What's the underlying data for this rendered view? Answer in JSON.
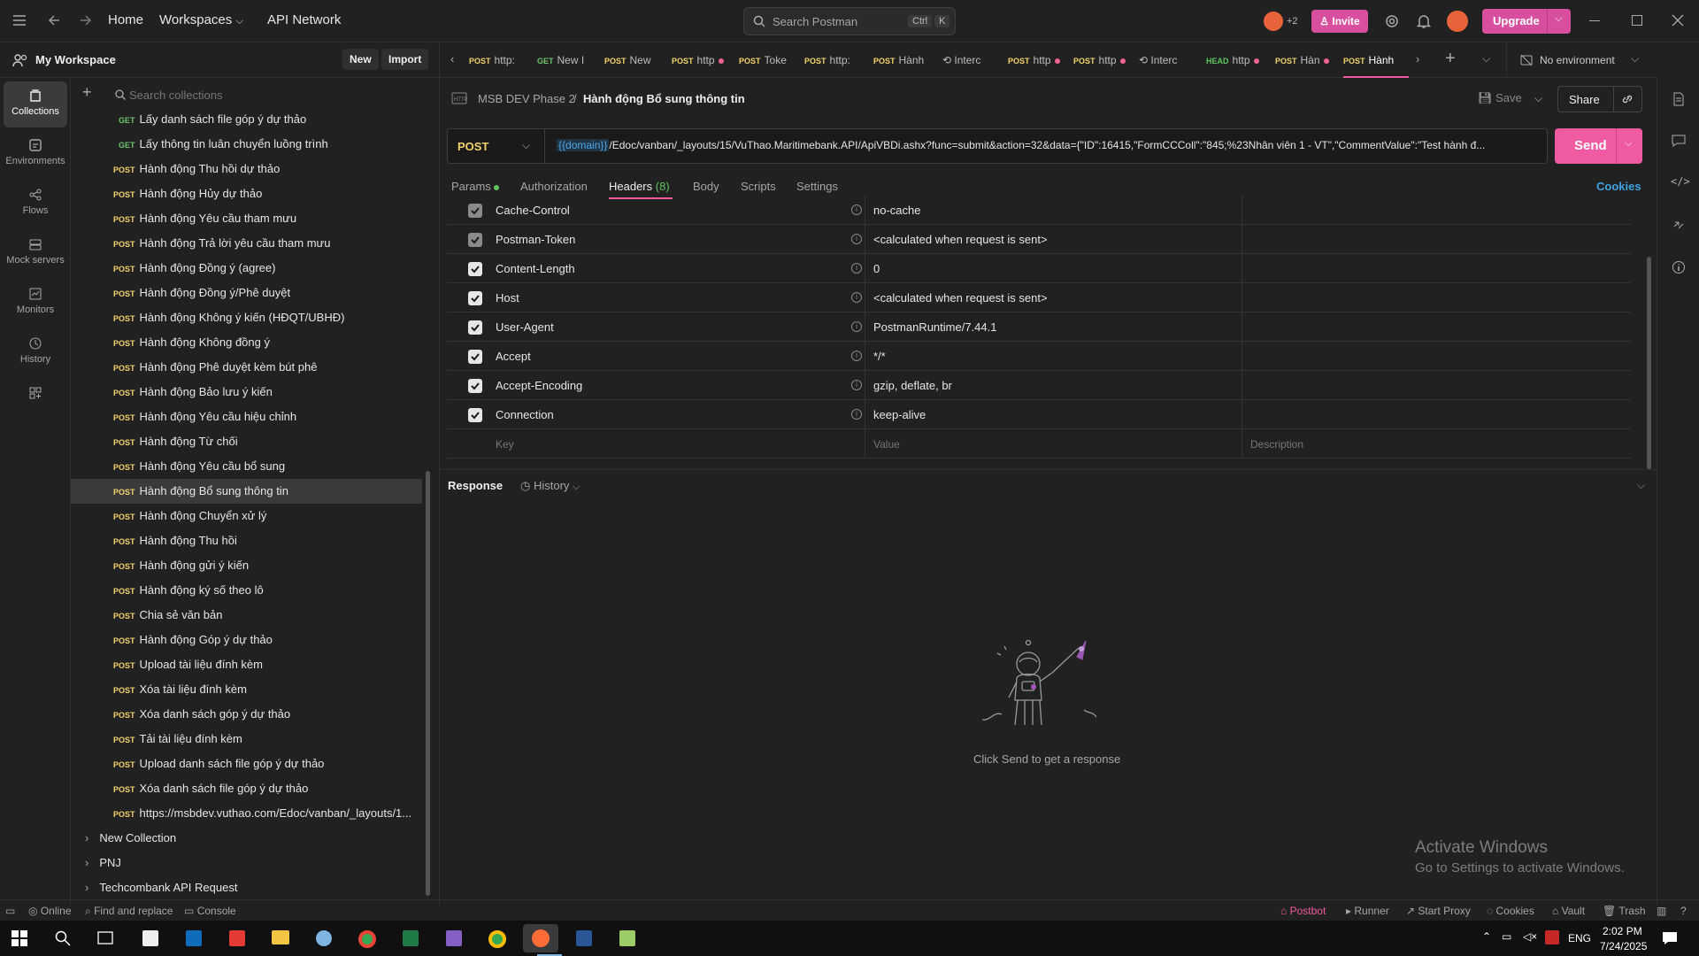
{
  "topbar": {
    "home": "Home",
    "workspaces": "Workspaces",
    "api_network": "API Network",
    "search_placeholder": "Search Postman",
    "search_kbd1": "Ctrl",
    "search_kbd2": "K",
    "avatar_count": "+2",
    "invite": "Invite",
    "upgrade": "Upgrade"
  },
  "workspace": {
    "title": "My Workspace",
    "new": "New",
    "import": "Import"
  },
  "rail": [
    {
      "label": "Collections",
      "icon": "collections-icon",
      "active": true
    },
    {
      "label": "Environments",
      "icon": "environments-icon"
    },
    {
      "label": "Flows",
      "icon": "flows-icon"
    },
    {
      "label": "Mock servers",
      "icon": "mock-servers-icon"
    },
    {
      "label": "Monitors",
      "icon": "monitors-icon"
    },
    {
      "label": "History",
      "icon": "history-icon"
    }
  ],
  "sidebar": {
    "search_placeholder": "Search collections",
    "items": [
      {
        "m": "GET",
        "label": "Lấy danh sách file góp ý dự thảo",
        "indent": 1
      },
      {
        "m": "GET",
        "label": "Lấy thông tin luân chuyển luồng trình",
        "indent": 1
      },
      {
        "m": "POST",
        "label": "Hành động Thu hồi dự thảo"
      },
      {
        "m": "POST",
        "label": "Hành động Hủy dự thảo"
      },
      {
        "m": "POST",
        "label": "Hành động Yêu cầu tham mưu"
      },
      {
        "m": "POST",
        "label": "Hành động Trả lời yêu cầu tham mưu"
      },
      {
        "m": "POST",
        "label": "Hành động Đồng ý (agree)"
      },
      {
        "m": "POST",
        "label": "Hành động Đồng ý/Phê duyệt"
      },
      {
        "m": "POST",
        "label": "Hành động Không ý kiến (HĐQT/UBHĐ)"
      },
      {
        "m": "POST",
        "label": "Hành động Không đồng ý"
      },
      {
        "m": "POST",
        "label": "Hành động Phê duyệt kèm bút phê"
      },
      {
        "m": "POST",
        "label": "Hành động Bảo lưu ý kiến"
      },
      {
        "m": "POST",
        "label": "Hành động Yêu cầu hiệu chỉnh"
      },
      {
        "m": "POST",
        "label": "Hành động Từ chối"
      },
      {
        "m": "POST",
        "label": "Hành động Yêu cầu bổ sung"
      },
      {
        "m": "POST",
        "label": "Hành động Bổ sung thông tin",
        "selected": true
      },
      {
        "m": "POST",
        "label": "Hành động Chuyển xử lý"
      },
      {
        "m": "POST",
        "label": "Hành động Thu hồi"
      },
      {
        "m": "POST",
        "label": "Hành động gửi ý kiến"
      },
      {
        "m": "POST",
        "label": "Hành động ký số theo lô"
      },
      {
        "m": "POST",
        "label": "Chia sẻ văn bản"
      },
      {
        "m": "POST",
        "label": "Hành động Góp ý dự thảo"
      },
      {
        "m": "POST",
        "label": "Upload tài liệu đính kèm"
      },
      {
        "m": "POST",
        "label": "Xóa tài liệu đính kèm"
      },
      {
        "m": "POST",
        "label": "Xóa danh sách góp ý dự thảo"
      },
      {
        "m": "POST",
        "label": "Tải tài liệu đính kèm"
      },
      {
        "m": "POST",
        "label": "Upload danh sách file góp ý dự thảo"
      },
      {
        "m": "POST",
        "label": "Xóa danh sách file góp ý dự thảo"
      },
      {
        "m": "POST",
        "label": "https://msbdev.vuthao.com/Edoc/vanban/_layouts/1..."
      }
    ],
    "collections": [
      "New Collection",
      "PNJ",
      "Techcombank API Request"
    ]
  },
  "tabs": [
    {
      "m": "POST",
      "label": "http:"
    },
    {
      "m": "GET",
      "label": "New I"
    },
    {
      "m": "POST",
      "label": "New"
    },
    {
      "m": "POST",
      "label": "http",
      "dot": true
    },
    {
      "m": "POST",
      "label": "Toke"
    },
    {
      "m": "POST",
      "label": "http:"
    },
    {
      "m": "POST",
      "label": "Hành"
    },
    {
      "m": "",
      "label": "Interc"
    },
    {
      "m": "POST",
      "label": "http",
      "dot": true
    },
    {
      "m": "POST",
      "label": "http",
      "dot": true
    },
    {
      "m": "",
      "label": "Interc"
    },
    {
      "m": "HEAD",
      "label": "http",
      "dot": true
    },
    {
      "m": "POST",
      "label": "Hàn",
      "dot": true
    },
    {
      "m": "POST",
      "label": "Hành",
      "active": true
    }
  ],
  "environment": "No environment",
  "breadcrumb": {
    "collection": "MSB DEV Phase 2",
    "sep": "/",
    "request": "Hành động Bổ sung thông tin"
  },
  "actions": {
    "save": "Save",
    "share": "Share"
  },
  "request": {
    "method": "POST",
    "url_var": "{{domain}}",
    "url_rest": "/Edoc/vanban/_layouts/15/VuThao.Maritimebank.API/ApiVBDi.ashx?func=submit&action=32&data={\"ID\":16415,\"FormCCColl\":\"845;%23Nhân viên 1 - VT\",\"CommentValue\":\"Test hành đ...",
    "send": "Send"
  },
  "subtabs": {
    "params": "Params",
    "authorization": "Authorization",
    "headers": "Headers",
    "headers_count": "(8)",
    "body": "Body",
    "scripts": "Scripts",
    "settings": "Settings",
    "cookies": "Cookies"
  },
  "headers": [
    {
      "key": "Cache-Control",
      "value": "no-cache",
      "dim": true
    },
    {
      "key": "Postman-Token",
      "value": "<calculated when request is sent>",
      "dim": true
    },
    {
      "key": "Content-Length",
      "value": "0"
    },
    {
      "key": "Host",
      "value": "<calculated when request is sent>"
    },
    {
      "key": "User-Agent",
      "value": "PostmanRuntime/7.44.1"
    },
    {
      "key": "Accept",
      "value": "*/*"
    },
    {
      "key": "Accept-Encoding",
      "value": "gzip, deflate, br"
    },
    {
      "key": "Connection",
      "value": "keep-alive"
    }
  ],
  "header_placeholders": {
    "key": "Key",
    "value": "Value",
    "description": "Description"
  },
  "response": {
    "title": "Response",
    "history": "History",
    "empty": "Click Send to get a response"
  },
  "watermark": {
    "line1": "Activate Windows",
    "line2": "Go to Settings to activate Windows."
  },
  "statusbar": {
    "online": "Online",
    "find": "Find and replace",
    "console": "Console",
    "postbot": "Postbot",
    "runner": "Runner",
    "proxy": "Start Proxy",
    "cookies": "Cookies",
    "vault": "Vault",
    "trash": "Trash"
  },
  "taskbar": {
    "lang": "ENG",
    "time": "2:02 PM",
    "date": "7/24/2025"
  }
}
